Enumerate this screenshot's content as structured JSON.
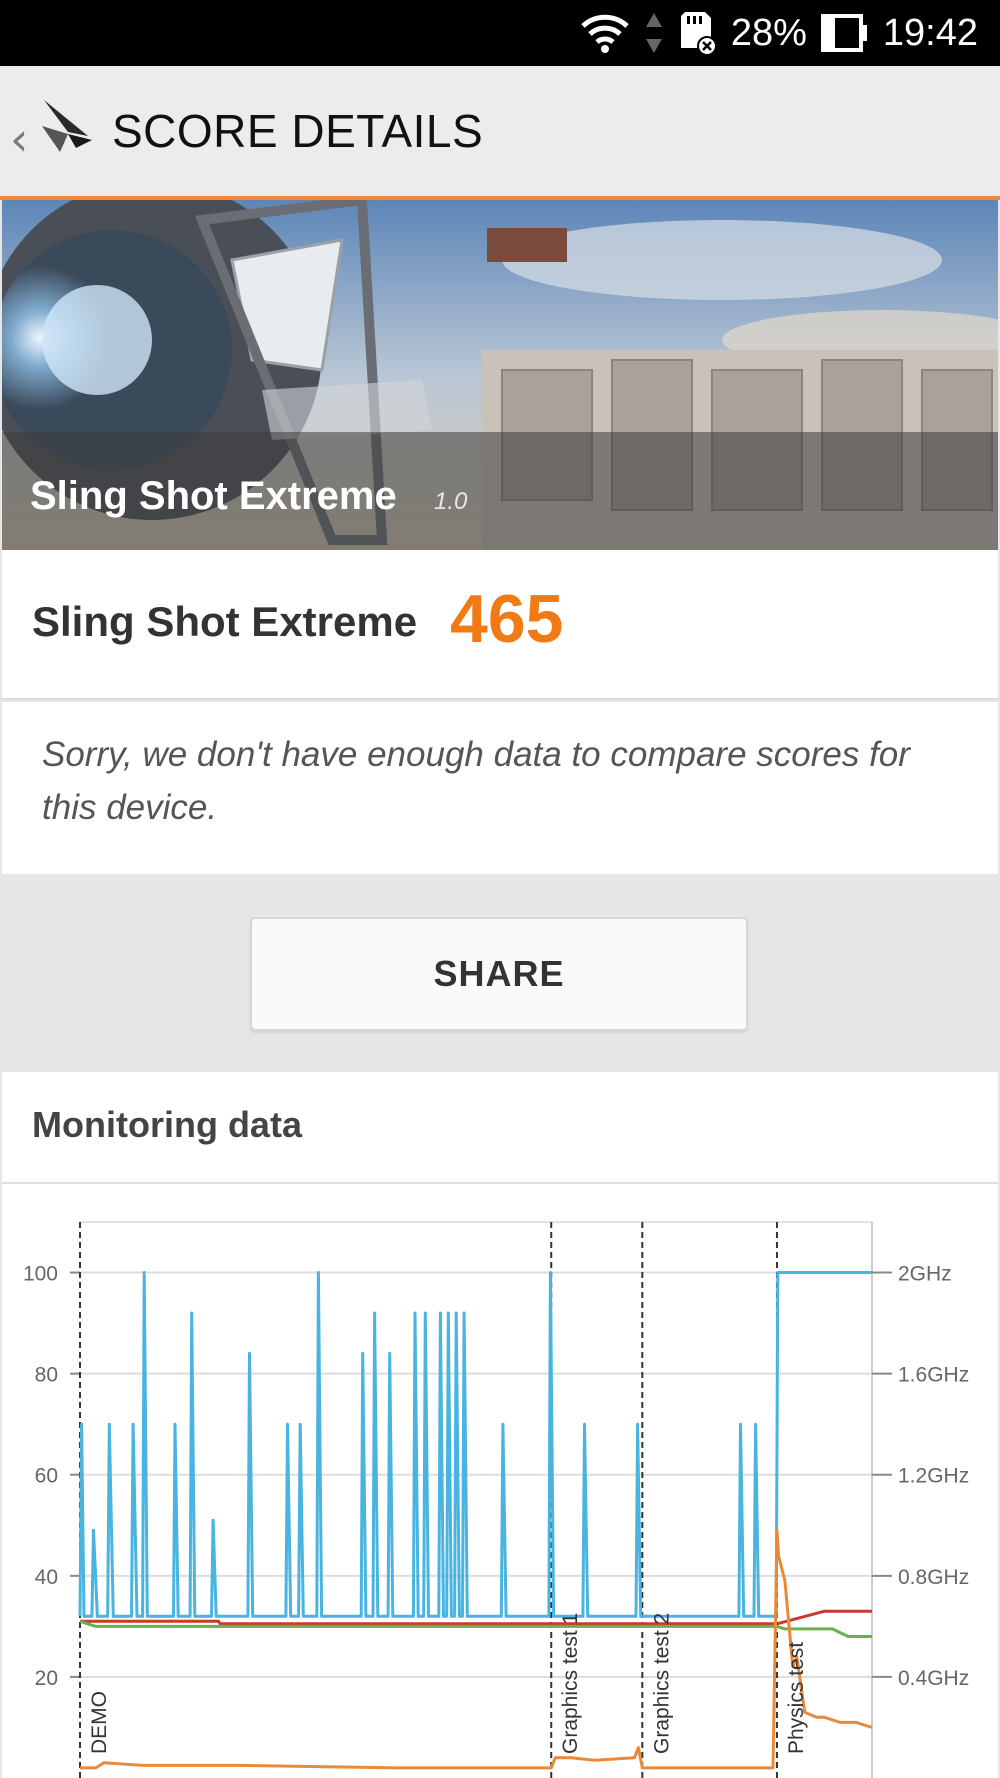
{
  "status_bar": {
    "battery_percent": "28%",
    "time": "19:42",
    "icons": [
      "wifi-icon",
      "data-arrows-icon",
      "sd-card-icon",
      "battery-icon"
    ]
  },
  "header": {
    "title": "SCORE DETAILS",
    "back_icon": "chevron-left-icon",
    "logo_icon": "3dmark-logo-icon"
  },
  "banner": {
    "test_name": "Sling Shot Extreme",
    "version": "1.0"
  },
  "score": {
    "label": "Sling Shot Extreme",
    "value": "465",
    "value_color": "#f07a14"
  },
  "message": "Sorry, we don't have enough data to compare scores for this device.",
  "share_label": "SHARE",
  "monitoring": {
    "title": "Monitoring data"
  },
  "chart_data": {
    "type": "line",
    "left_axis_ticks": [
      "100",
      "80",
      "60",
      "40",
      "20"
    ],
    "right_axis_ticks": [
      "2GHz",
      "1.6GHz",
      "1.2GHz",
      "0.8GHz",
      "0.4GHz"
    ],
    "ylim_left": [
      0,
      110
    ],
    "ylim_right_ghz": [
      0,
      2.2
    ],
    "x_range_s": [
      0,
      100
    ],
    "grid": true,
    "segments": [
      {
        "label": "DEMO",
        "start": 0
      },
      {
        "label": "Graphics test 1",
        "start": 59.5
      },
      {
        "label": "Graphics test 2",
        "start": 71
      },
      {
        "label": "Physics test",
        "start": 88
      }
    ],
    "series": [
      {
        "color": "#4ab4e0",
        "x": [
          0,
          0.2,
          0.5,
          1.5,
          1.7,
          2.2,
          3.5,
          3.7,
          4.2,
          6.5,
          6.7,
          7.2,
          7.9,
          8.1,
          8.5,
          11.8,
          12,
          12.4,
          13.9,
          14.1,
          14.5,
          16.6,
          16.8,
          17.2,
          21.2,
          21.4,
          21.8,
          26,
          26.2,
          26.6,
          27.6,
          27.8,
          28.2,
          29.9,
          30.1,
          30.5,
          35.5,
          35.7,
          36.1,
          37,
          37.2,
          37.6,
          38.9,
          39.1,
          39.5,
          42.1,
          42.3,
          42.7,
          43.4,
          43.6,
          44,
          45.3,
          45.5,
          45.9,
          46.3,
          46.5,
          46.9,
          47.3,
          47.5,
          47.9,
          48.3,
          48.5,
          48.9,
          53.2,
          53.4,
          53.8,
          59.2,
          59.4,
          59.8,
          63.5,
          63.7,
          64.1,
          70.2,
          70.4,
          70.8,
          83.2,
          83.4,
          83.8,
          85.1,
          85.3,
          85.7,
          87.9,
          88.1,
          100
        ],
        "values": [
          32,
          70,
          32,
          32,
          49,
          32,
          32,
          70,
          32,
          32,
          70,
          32,
          32,
          100,
          32,
          32,
          70,
          32,
          32,
          92,
          32,
          32,
          51,
          32,
          32,
          84,
          32,
          32,
          70,
          32,
          32,
          70,
          32,
          32,
          100,
          32,
          32,
          84,
          32,
          32,
          92,
          32,
          32,
          84,
          32,
          32,
          92,
          32,
          32,
          92,
          32,
          32,
          92,
          32,
          32,
          92,
          32,
          32,
          92,
          32,
          32,
          92,
          32,
          32,
          70,
          32,
          32,
          100,
          32,
          32,
          70,
          32,
          32,
          70,
          32,
          32,
          70,
          32,
          32,
          70,
          32,
          32,
          100,
          100
        ]
      },
      {
        "color": "#c83a2a",
        "x": [
          0,
          17.5,
          17.7,
          88,
          94,
          100
        ],
        "values": [
          31,
          31,
          30.5,
          30.5,
          33,
          33
        ]
      },
      {
        "color": "#6ab04c",
        "x": [
          0,
          2,
          88,
          89,
          95,
          97,
          100
        ],
        "values": [
          31,
          30,
          30,
          29.5,
          29.5,
          28,
          28
        ]
      },
      {
        "color": "#e88a3a",
        "x": [
          0,
          2,
          3,
          8,
          20,
          40,
          58,
          59.5,
          60,
          62,
          65,
          70,
          70.5,
          71,
          75,
          87.5,
          88,
          88.2,
          89,
          90,
          90.5,
          91.5,
          93,
          94,
          96,
          98,
          100
        ],
        "values": [
          2,
          2,
          3,
          2.5,
          2.5,
          2,
          2,
          2,
          4,
          4,
          3.5,
          4,
          6,
          2,
          2,
          2,
          49,
          44,
          39,
          22,
          24,
          13,
          12,
          12,
          11,
          11,
          10
        ]
      }
    ]
  }
}
